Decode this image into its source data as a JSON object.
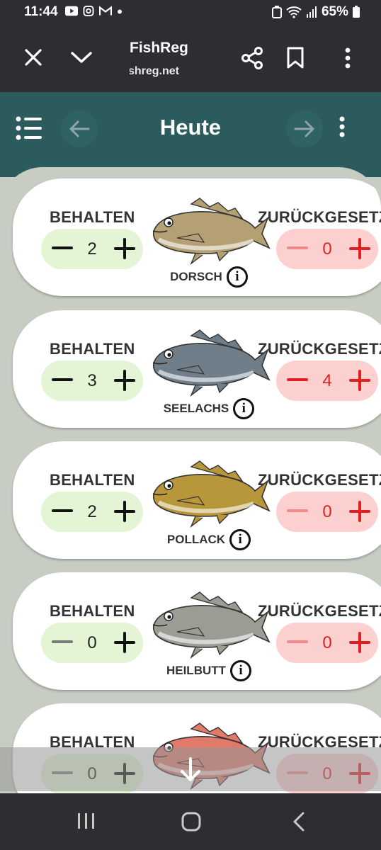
{
  "status": {
    "time": "11:44",
    "battery": "65%",
    "icons": [
      "youtube-icon",
      "instagram-icon",
      "gmail-icon",
      "dot-icon"
    ],
    "right_icons": [
      "battery-saver-icon",
      "wifi-icon",
      "signal-icon",
      "battery-icon"
    ]
  },
  "browser": {
    "title": "FishReg",
    "url": "fishreg.net",
    "buttons": [
      "close-icon",
      "chevron-down-icon",
      "share-icon",
      "bookmark-icon",
      "more-vert-icon"
    ]
  },
  "appbar": {
    "title": "Heute"
  },
  "labels": {
    "keep": "BEHALTEN",
    "release": "ZURÜCKGESETZT"
  },
  "fish": [
    {
      "name": "DORSCH",
      "kept": "2",
      "released": "0",
      "kept_minus_active": true,
      "released_minus_active": false,
      "color": "#b5a074"
    },
    {
      "name": "SEELACHS",
      "kept": "3",
      "released": "4",
      "kept_minus_active": true,
      "released_minus_active": true,
      "color": "#6f7e89"
    },
    {
      "name": "POLLACK",
      "kept": "2",
      "released": "0",
      "kept_minus_active": true,
      "released_minus_active": false,
      "color": "#b8963a"
    },
    {
      "name": "HEILBUTT",
      "kept": "0",
      "released": "0",
      "kept_minus_active": false,
      "released_minus_active": false,
      "color": "#9c9c95"
    },
    {
      "name": "",
      "kept": "0",
      "released": "0",
      "kept_minus_active": false,
      "released_minus_active": false,
      "color": "#e27a6a"
    }
  ],
  "colors": {
    "topbar": "#2c2e32",
    "appbar": "#2b5b5c",
    "keep_pill": "#e3f5d5",
    "release_pill": "#fdd0d0",
    "release_active": "#e02020"
  },
  "nav": [
    "recent-apps-icon",
    "home-icon",
    "back-icon"
  ]
}
